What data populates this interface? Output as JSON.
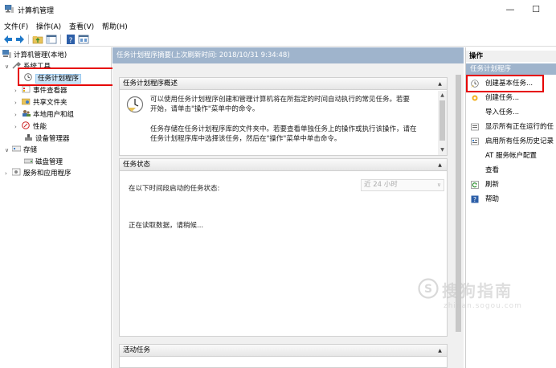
{
  "window": {
    "title": "计算机管理",
    "minimize": "—",
    "maximize": "☐"
  },
  "menu": [
    "文件(F)",
    "操作(A)",
    "查看(V)",
    "帮助(H)"
  ],
  "tree": {
    "root": "计算机管理(本地)",
    "system_tools": "系统工具",
    "task_scheduler": "任务计划程序",
    "event_viewer": "事件查看器",
    "shared_folders": "共享文件夹",
    "local_users": "本地用户和组",
    "performance": "性能",
    "device_manager": "设备管理器",
    "storage": "存储",
    "disk_management": "磁盘管理",
    "services_apps": "服务和应用程序"
  },
  "center": {
    "header": "任务计划程序摘要(上次刷新时间: 2018/10/31 9:34:48)",
    "overview_title": "任务计划程序概述",
    "overview_p1_l1": "可以使用任务计划程序创建和管理计算机将在所指定的时间自动执行的常见任务。若要",
    "overview_p1_l2": "开始，请单击\"操作\"菜单中的命令。",
    "overview_p2_l1": "任务存储在任务计划程序库的文件夹中。若要查看单独任务上的操作或执行该操作，请在",
    "overview_p2_l2": "任务计划程序库中选择该任务，然后在\"操作\"菜单中单击命令。",
    "status_title": "任务状态",
    "status_label": "在以下时间段启动的任务状态:",
    "status_range": "近 24 小时",
    "loading": "正在读取数据，请稍候...",
    "active_title": "活动任务"
  },
  "actions": {
    "title": "操作",
    "subtitle": "任务计划程序",
    "items": [
      {
        "label": "创建基本任务...",
        "icon": "create-basic-task-icon"
      },
      {
        "label": "创建任务...",
        "icon": "create-task-icon"
      },
      {
        "label": "导入任务...",
        "icon": ""
      },
      {
        "label": "显示所有正在运行的任",
        "icon": "running-tasks-icon"
      },
      {
        "label": "启用所有任务历史记录",
        "icon": "history-icon"
      },
      {
        "label": "AT 服务帐户配置",
        "icon": ""
      },
      {
        "label": "查看",
        "icon": ""
      },
      {
        "label": "刷新",
        "icon": "refresh-icon"
      },
      {
        "label": "帮助",
        "icon": "help-icon"
      }
    ]
  },
  "watermark": {
    "brand": "搜狗指南",
    "url": "zhinan.sogou.com"
  }
}
